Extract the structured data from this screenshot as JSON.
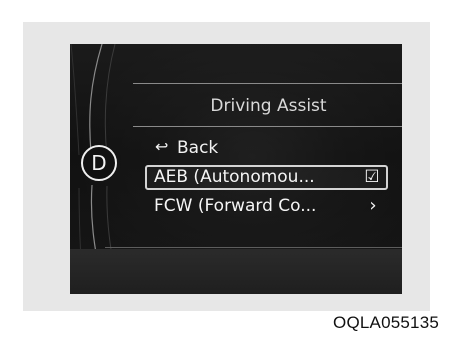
{
  "display": {
    "gear": "D",
    "menu_title": "Driving Assist",
    "back_label": "Back",
    "items": [
      {
        "label": "AEB (Autonomou...",
        "selected": true,
        "right_icon": "checkbox-checked-icon"
      },
      {
        "label": "FCW (Forward Co...",
        "selected": false,
        "right_icon": "chevron-right-icon"
      }
    ]
  },
  "caption": {
    "code": "OQLA055135"
  },
  "icons": {
    "back": "back-arrow-icon",
    "checkbox": "checkbox-checked-icon",
    "chevron": "chevron-right-icon"
  },
  "colors": {
    "panel_bg": "#e7e7e7",
    "screen_bg": "#151515",
    "text": "#f5f5f5",
    "muted_text": "#d9d9d9",
    "divider": "#8a8a8a"
  }
}
